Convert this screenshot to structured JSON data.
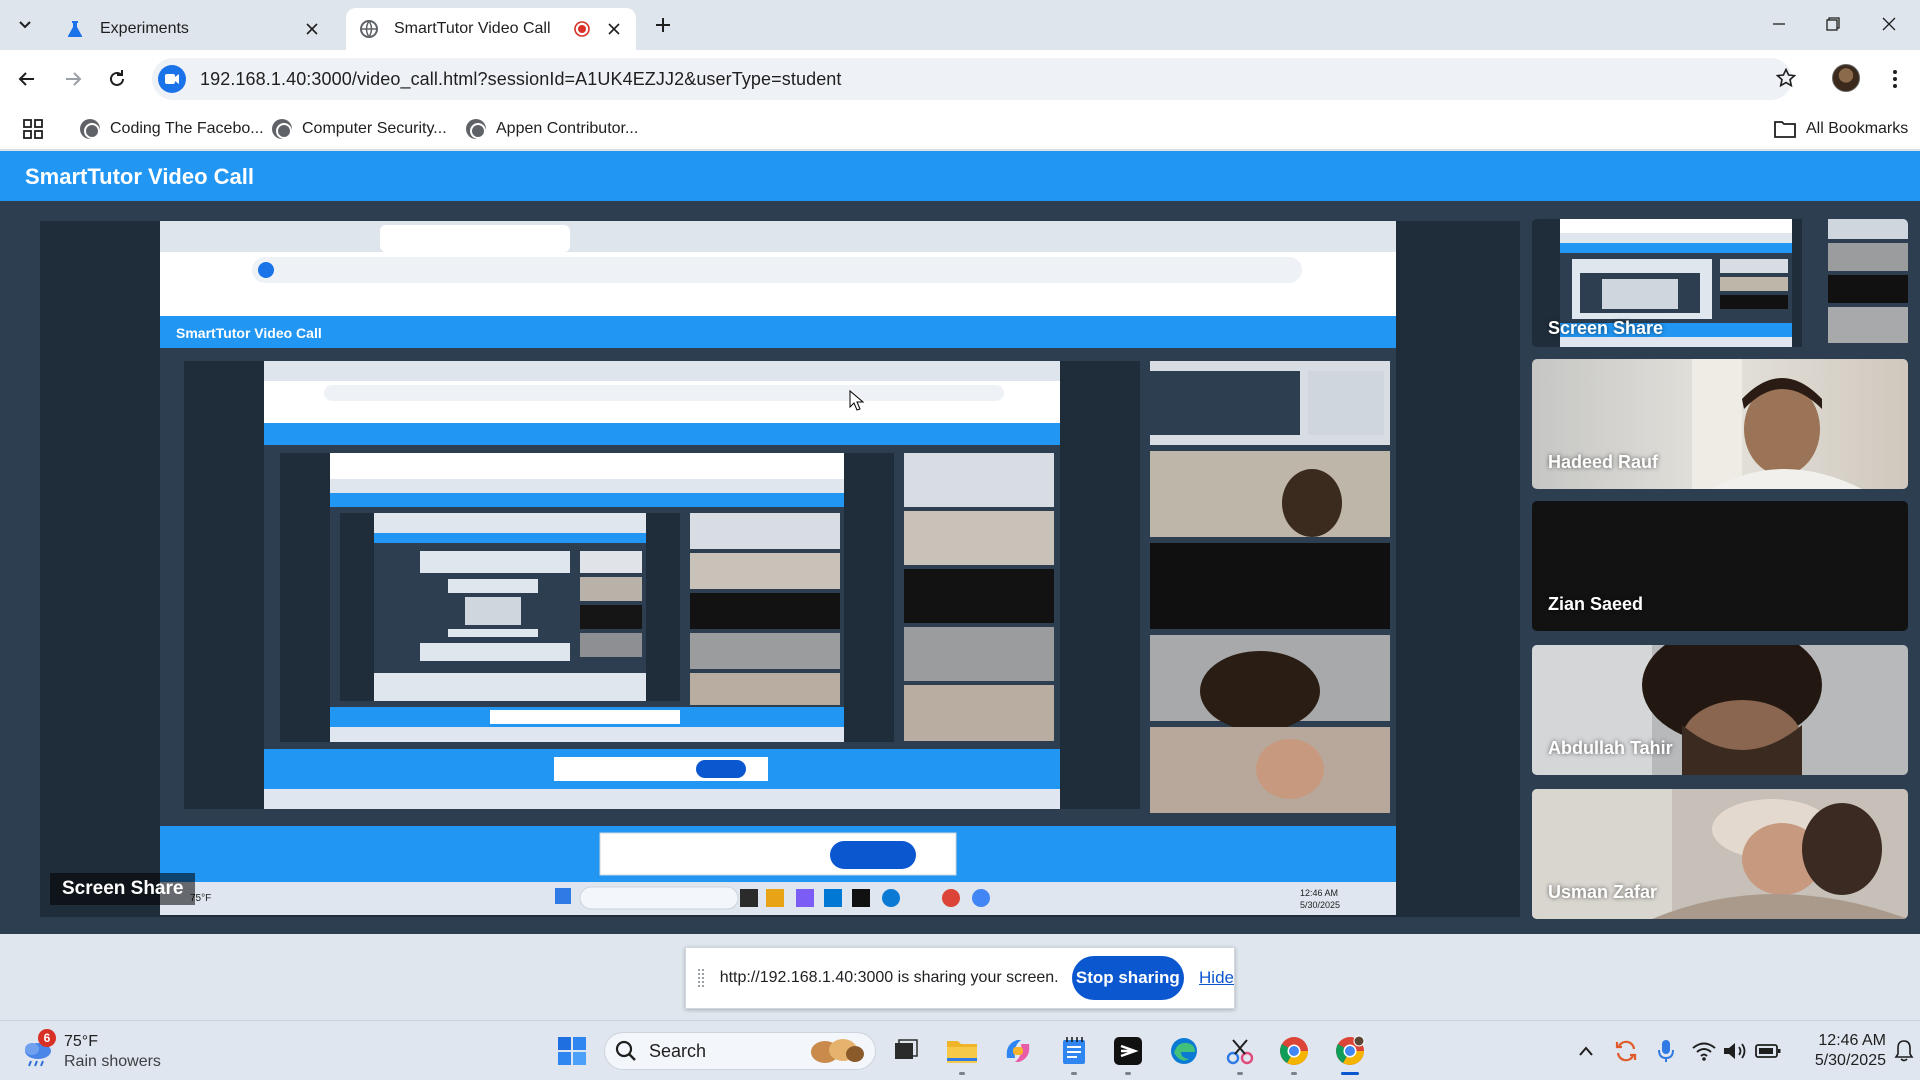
{
  "browser": {
    "tabs": [
      {
        "title": "Experiments",
        "active": false
      },
      {
        "title": "SmartTutor Video Call",
        "active": true
      }
    ],
    "url": "192.168.1.40:3000/video_call.html?sessionId=A1UK4EZJJ2&userType=student",
    "bookmarks": [
      "Coding The Facebo...",
      "Computer Security...",
      "Appen Contributor..."
    ],
    "all_bookmarks_label": "All Bookmarks"
  },
  "app": {
    "title": "SmartTutor Video Call",
    "main_video_label": "Screen Share",
    "participants": [
      {
        "name": "Screen Share"
      },
      {
        "name": "Hadeed Rauf"
      },
      {
        "name": "Zian Saeed"
      },
      {
        "name": "Abdullah Tahir"
      },
      {
        "name": "Usman Zafar"
      }
    ],
    "nested_title": "SmartTutor Video Call",
    "nested_label": "Screen Share"
  },
  "share_bar": {
    "message": "http://192.168.1.40:3000 is sharing your screen.",
    "stop_label": "Stop sharing",
    "hide_label": "Hide"
  },
  "taskbar": {
    "weather_badge": "6",
    "temperature": "75°F",
    "condition": "Rain showers",
    "search_label": "Search",
    "time": "12:46 AM",
    "date": "5/30/2025"
  },
  "colors": {
    "app_header": "#2196f3",
    "app_body": "#2c3e50",
    "stop_button": "#0b57d0"
  }
}
